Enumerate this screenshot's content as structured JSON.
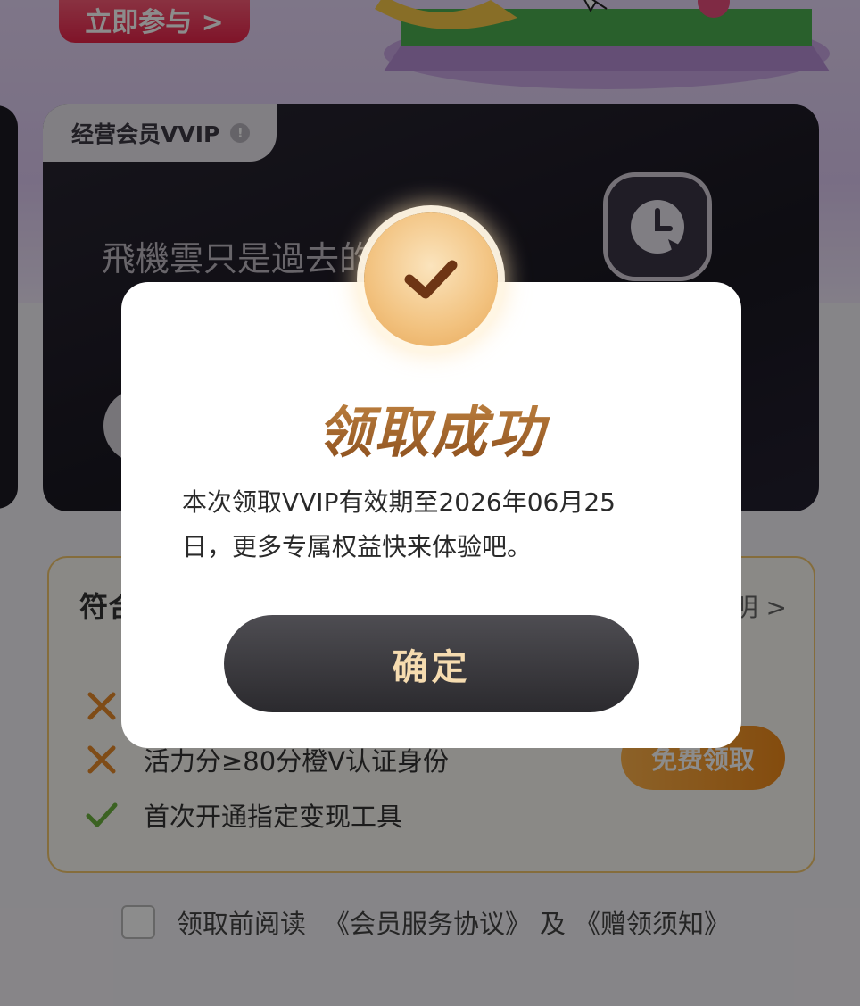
{
  "hero": {
    "join_label": "立即参与 >"
  },
  "vvip_card": {
    "tag_label": "经营会员VVIP",
    "info_icon_glyph": "!",
    "slogan": "飛機雲只是過去的"
  },
  "conditions": {
    "title": "符合",
    "explain_link": "明 >",
    "items": [
      {
        "status": "fail",
        "text": ""
      },
      {
        "status": "fail",
        "text": "活力分≥80分橙V认证身份"
      },
      {
        "status": "pass",
        "text": "首次开通指定变现工具"
      }
    ],
    "free_button_label": "免费领取"
  },
  "agreement": {
    "prefix": "领取前阅读",
    "link1": "《会员服务协议》",
    "joiner": "及",
    "link2": "《赠领须知》"
  },
  "modal": {
    "title": "领取成功",
    "description": "本次领取VVIP有效期至2026年06月25日，更多专属权益快来体验吧。",
    "confirm_label": "确定"
  },
  "colors": {
    "accent_gold": "#a8652a",
    "confirm_text": "#f6dcb0",
    "fail_mark": "#e88a2a",
    "pass_mark": "#6cb33f",
    "free_button": "#f08a1a",
    "join_button": "#e8244a"
  },
  "icons": {
    "success": "checkmark-icon",
    "fail": "cross-icon",
    "pass": "check-icon",
    "clock": "clock-icon"
  }
}
